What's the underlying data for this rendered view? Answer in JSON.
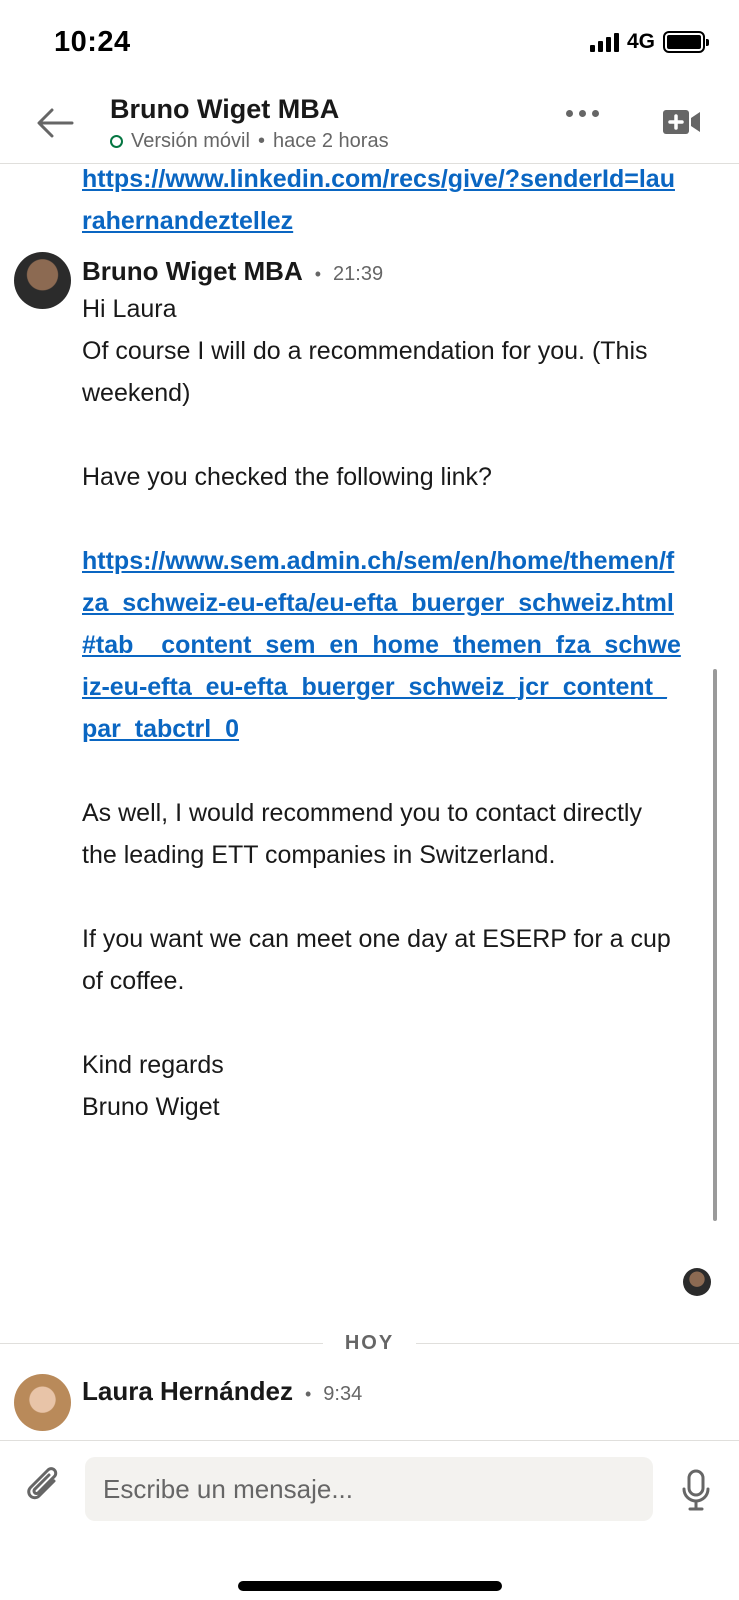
{
  "status_bar": {
    "time": "10:24",
    "network": "4G",
    "icons": [
      "signal-bars-icon",
      "battery-icon"
    ]
  },
  "header": {
    "title": "Bruno Wiget MBA",
    "presence": "Versión móvil",
    "separator": "•",
    "last_seen": "hace 2 horas",
    "icons": [
      "back-arrow-icon",
      "more-icon",
      "video-call-icon"
    ]
  },
  "thread": {
    "previous_link": "https://www.linkedin.com/recs/give/?senderId=laurahernandeztellez",
    "messages": [
      {
        "sender": "Bruno Wiget MBA",
        "dot": "•",
        "time": "21:39",
        "paragraphs": [
          "Hi Laura",
          "Of course I will do a recommendation for you. (This weekend)",
          "",
          "Have you checked the following link?",
          "",
          "https://www.sem.admin.ch/sem/en/home/themen/fza_schweiz-eu-efta/eu-efta_buerger_schweiz.html#tab__content_sem_en_home_themen_fza_schweiz-eu-efta_eu-efta_buerger_schweiz_jcr_content_par_tabctrl_0",
          "",
          "As well, I would recommend you to contact directly  the leading ETT companies in Switzerland.",
          "",
          "If you want we can meet one day at ESERP for a cup of coffee.",
          "",
          "Kind regards",
          "Bruno Wiget"
        ]
      },
      {
        "sender": "Laura Hernández",
        "dot": "•",
        "time": "9:34"
      }
    ],
    "day_divider": "HOY"
  },
  "composer": {
    "placeholder": "Escribe un mensaje...",
    "icons": [
      "paperclip-icon",
      "microphone-icon"
    ]
  },
  "colors": {
    "link": "#0a66c2",
    "online": "#057642",
    "muted_text": "#666666",
    "input_bg": "#f3f2ef"
  }
}
